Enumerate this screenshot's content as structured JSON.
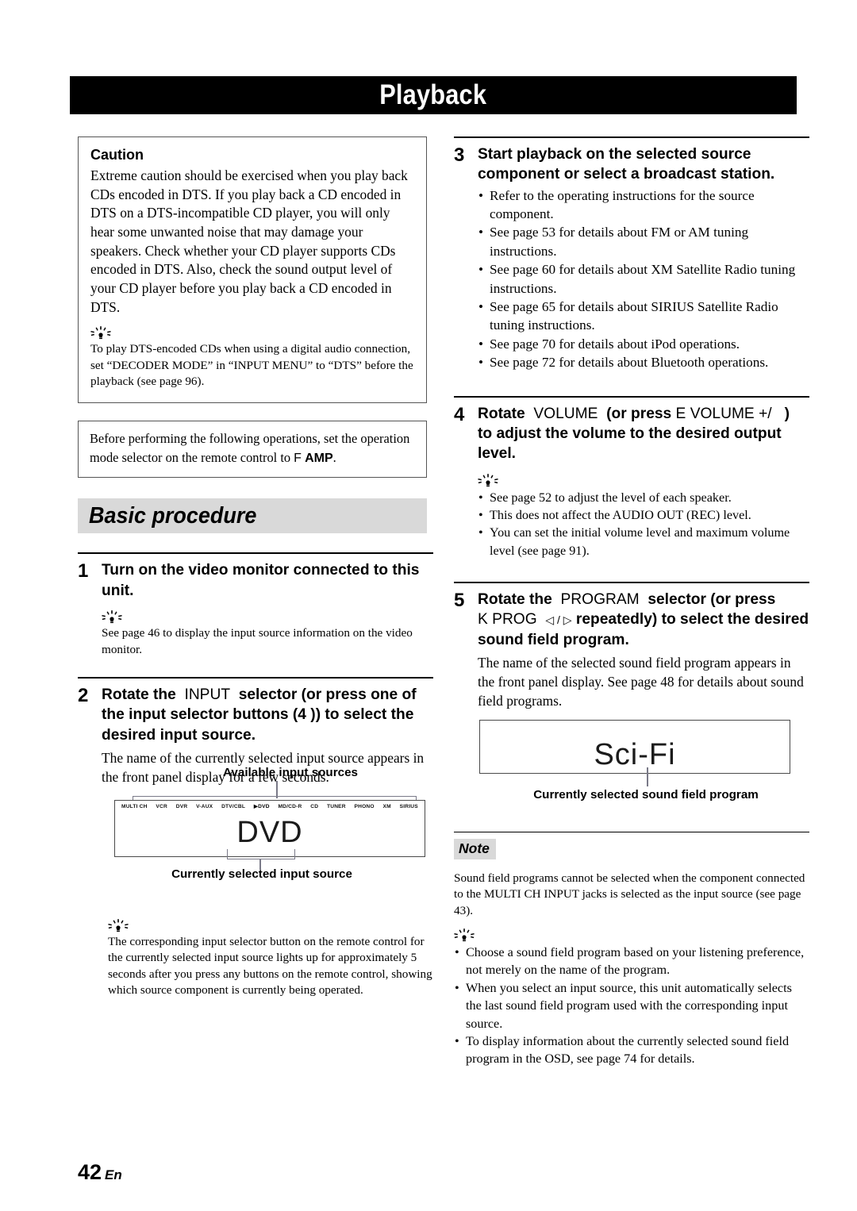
{
  "header": {
    "title": "Playback"
  },
  "left": {
    "caution": {
      "title": "Caution",
      "body": "Extreme caution should be exercised when you play back CDs encoded in DTS. If you play back a CD encoded in DTS on a DTS-incompatible CD player, you will only hear some unwanted noise that may damage your speakers. Check whether your CD player supports CDs encoded in DTS. Also, check the sound output level of your CD player before you play back a CD encoded in DTS.",
      "tip": "To play DTS-encoded CDs when using a digital audio connection, set “DECODER MODE” in “INPUT MENU” to “DTS” before the playback (see page 96)."
    },
    "before_note": {
      "text_before": "Before performing the following operations, set the operation mode selector on the remote control to ",
      "key_mark": "F",
      "key_label": "AMP",
      "text_after": "."
    },
    "section_heading": "Basic procedure",
    "step1": {
      "num": "1",
      "title": "Turn on the video monitor connected to this unit.",
      "tip": "See page 46 to display the input source information on the video monitor."
    },
    "step2": {
      "num": "2",
      "title_a": "Rotate the",
      "title_key": "INPUT",
      "title_b": "selector (or press one of the input selector buttons (4 )) to select the desired input source.",
      "desc": "The name of the currently selected input source appears in the front panel display for a few seconds.",
      "panel": {
        "caption_top": "Available input sources",
        "caption_bottom": "Currently selected input source",
        "sources": [
          "MULTI CH",
          "VCR",
          "DVR",
          "V-AUX",
          "DTV/CBL",
          "▶DVD",
          "MD/CD-R",
          "CD",
          "TUNER",
          "PHONO",
          "XM",
          "SIRIUS"
        ],
        "readout": "DVD"
      },
      "tip": "The corresponding input selector button on the remote control for the currently selected input source lights up for approximately 5 seconds after you press any buttons on the remote control, showing which source component is currently being operated."
    }
  },
  "right": {
    "step3": {
      "num": "3",
      "title": "Start playback on the selected source component or select a broadcast station.",
      "bullets": [
        "Refer to the operating instructions for the source component.",
        "See page 53 for details about FM or AM tuning instructions.",
        "See page 60 for details about XM Satellite Radio tuning instructions.",
        "See page 65 for details about SIRIUS Satellite Radio tuning instructions.",
        "See page 70 for details about iPod operations.",
        "See page 72 for details about Bluetooth operations."
      ]
    },
    "step4": {
      "num": "4",
      "title_a": "Rotate",
      "title_key": "VOLUME",
      "title_b": "(or press",
      "title_mark": "E",
      "title_key2": "VOLUME +/",
      "title_c": ")",
      "title_d": "to adjust the volume to the desired output level.",
      "bullets": [
        "See page 52 to adjust the level of each speaker.",
        "This does not affect the AUDIO OUT (REC) level.",
        "You can set the initial volume level and maximum volume level (see page 91)."
      ]
    },
    "step5": {
      "num": "5",
      "title_a": "Rotate the",
      "title_key": "PROGRAM",
      "title_b": "selector (or press",
      "title_mark": "K",
      "title_key2": "PROG",
      "title_arrows": "◁ / ▷",
      "title_c": "repeatedly) to select the desired sound field program.",
      "desc": "The name of the selected sound field program appears in the front panel display. See page 48 for details about sound field programs.",
      "panel": {
        "caption_bottom": "Currently selected sound field program",
        "readout": "Sci-Fi"
      }
    },
    "note": {
      "tag": "Note",
      "body": "Sound field programs cannot be selected when the component connected to the MULTI CH INPUT jacks is selected as the input source (see page 43).",
      "bullets": [
        "Choose a sound field program based on your listening preference, not merely on the name of the program.",
        "When you select an input source, this unit automatically selects the last sound field program used with the corresponding input source.",
        "To display information about the currently selected sound field program in the OSD, see page 74 for details."
      ]
    }
  },
  "footer": {
    "page_number": "42",
    "language": "En"
  }
}
